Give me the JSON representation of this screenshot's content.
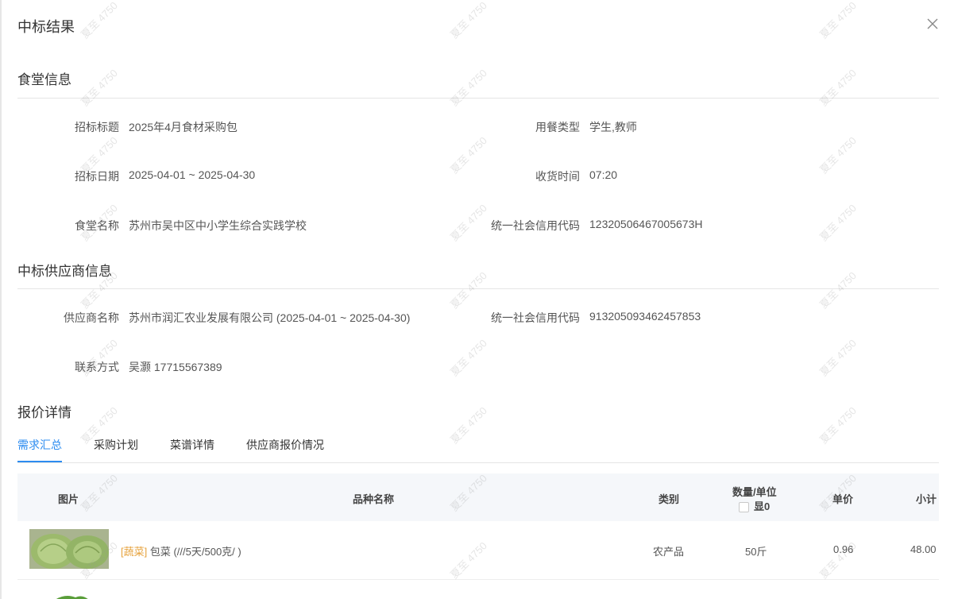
{
  "dialog": {
    "title": "中标结果",
    "close_icon": "close-icon"
  },
  "canteen": {
    "section_title": "食堂信息",
    "fields": [
      {
        "label": "招标标题",
        "value": "2025年4月食材采购包"
      },
      {
        "label": "用餐类型",
        "value": "学生,教师"
      },
      {
        "label": "招标日期",
        "value": "2025-04-01 ~ 2025-04-30"
      },
      {
        "label": "收货时间",
        "value": "07:20"
      },
      {
        "label": "食堂名称",
        "value": "苏州市吴中区中小学生综合实践学校"
      },
      {
        "label": "统一社会信用代码",
        "value": "12320506467005673H"
      }
    ]
  },
  "supplier": {
    "section_title": "中标供应商信息",
    "fields": [
      {
        "label": "供应商名称",
        "value": "苏州市润汇农业发展有限公司 (2025-04-01 ~ 2025-04-30)"
      },
      {
        "label": "统一社会信用代码",
        "value": "913205093462457853"
      },
      {
        "label": "联系方式",
        "value": "吴灏 17715567389"
      }
    ]
  },
  "quote": {
    "section_title": "报价详情",
    "tabs": [
      {
        "label": "需求汇总",
        "active": true
      },
      {
        "label": "采购计划",
        "active": false
      },
      {
        "label": "菜谱详情",
        "active": false
      },
      {
        "label": "供应商报价情况",
        "active": false
      }
    ],
    "columns": {
      "image": "图片",
      "name": "品种名称",
      "category": "类别",
      "qty_unit": "数量/单位",
      "show_zero": "显0",
      "price": "单价",
      "subtotal": "小计"
    },
    "rows": [
      {
        "category_tag": "[蔬菜]",
        "name": "包菜 (///5天/500克/ )",
        "category": "农产品",
        "qty": "50斤",
        "price": "0.96",
        "subtotal": "48.00"
      }
    ]
  },
  "watermark": {
    "text": "夏至 4750"
  },
  "colors": {
    "accent": "#2d8cf0",
    "tag": "#e6a23c",
    "header_bg": "#f5f7fa"
  }
}
